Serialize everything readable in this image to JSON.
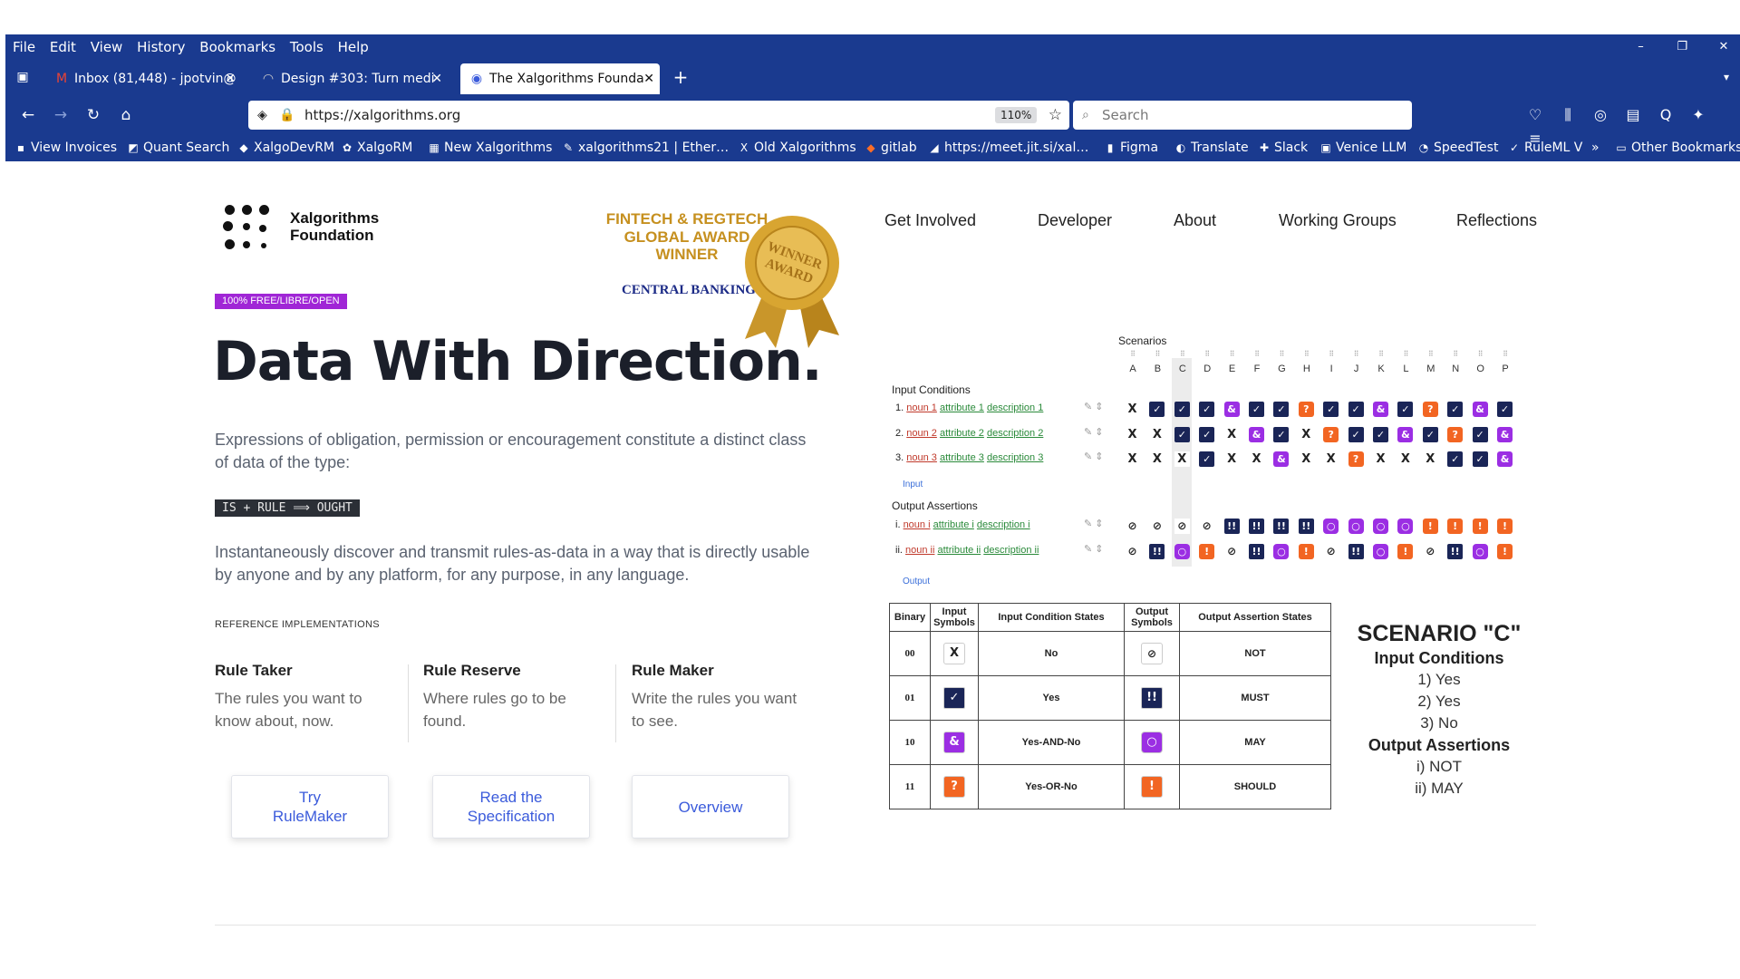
{
  "browser": {
    "menu": [
      "File",
      "Edit",
      "View",
      "History",
      "Bookmarks",
      "Tools",
      "Help"
    ],
    "window_controls": [
      "–",
      "❐",
      "✕"
    ],
    "tabs": [
      {
        "label": "Inbox (81,448) - jpotvin@",
        "icon": "gmail-icon"
      },
      {
        "label": "Design #303: Turn medi",
        "icon": "git-icon"
      },
      {
        "label": "The Xalgorithms Founda",
        "icon": "xalgo-icon"
      }
    ],
    "new_tab": "+",
    "url": "https://xalgorithms.org",
    "zoom": "110%",
    "search_placeholder": "Search",
    "bookmarks": [
      "View Invoices",
      "Quant Search",
      "XalgoDevRM",
      "XalgoRM",
      "New Xalgorithms",
      "xalgorithms21 | Ether…",
      "Old Xalgorithms",
      "gitlab",
      "https://meet.jit.si/xal…",
      "Figma",
      "Translate",
      "Slack",
      "Venice LLM",
      "SpeedTest",
      "RuleML V",
      "Other Bookmarks"
    ],
    "bookmarks_overflow": "»"
  },
  "site": {
    "logo_text_1": "Xalgorithms",
    "logo_text_2": "Foundation",
    "award_lines": [
      "FINTECH & REGTECH",
      "GLOBAL AWARD",
      "WINNER"
    ],
    "award_sub": "CENTRAL BANKING",
    "seal_line1": "WINNER",
    "seal_line2": "AWARD",
    "nav": [
      "Get Involved",
      "Developer",
      "About",
      "Working Groups",
      "Reflections"
    ],
    "badge": "100% FREE/LIBRE/OPEN",
    "title": "Data With Direction.",
    "intro": "Expressions of obligation, permission or encouragement constitute a distinct class of data of the type:",
    "code": "IS + RULE ⟹ OUGHT",
    "para2": "Instantaneously discover and transmit rules-as-data in a way that is directly usable by anyone and by any platform, for any purpose, in any language.",
    "ref_head": "REFERENCE IMPLEMENTATIONS",
    "impl": [
      {
        "title": "Rule Taker",
        "desc": "The rules you want to know about, now."
      },
      {
        "title": "Rule Reserve",
        "desc": "Where rules go to be found."
      },
      {
        "title": "Rule Maker",
        "desc": "Write the rules you want to see."
      }
    ],
    "buttons": [
      "Try RuleMaker",
      "Read the Specification",
      "Overview"
    ]
  },
  "grid": {
    "scenarios_label": "Scenarios",
    "columns": [
      "A",
      "B",
      "C",
      "D",
      "E",
      "F",
      "G",
      "H",
      "I",
      "J",
      "K",
      "L",
      "M",
      "N",
      "O",
      "P"
    ],
    "input_label": "Input Conditions",
    "inputs": [
      {
        "num": "1.",
        "noun": "noun 1",
        "attr": "attribute 1",
        "desc": "description 1",
        "cells": "XVVV AVVQ VVAV QVAV"
      },
      {
        "num": "2.",
        "noun": "noun 2",
        "attr": "attribute 2",
        "desc": "description 2",
        "cells": "XXVV XAVX QVVA VQVA"
      },
      {
        "num": "3.",
        "noun": "noun 3",
        "attr": "attribute 3",
        "desc": "description 3",
        "cells": "XXXV XXAX XQXX XVVA"
      }
    ],
    "input_link": "Input",
    "output_label": "Output Assertions",
    "outputs": [
      {
        "num": "i.",
        "noun": "noun i",
        "attr": "attribute i",
        "desc": "description i",
        "cells": "NNNN MMMM OOOO SSSS"
      },
      {
        "num": "ii.",
        "noun": "noun ii",
        "attr": "attribute ii",
        "desc": "description ii",
        "cells": "NMOS NMOS NMOS NMOS"
      }
    ],
    "output_link": "Output",
    "glyphs": {
      "X": "X",
      "V": "✓",
      "A": "&",
      "Q": "?",
      "N": "⊘",
      "M": "!!",
      "O": "○",
      "S": "!"
    }
  },
  "legend": {
    "headers": [
      "Binary",
      "Input Symbols",
      "Input Condition States",
      "Output Symbols",
      "Output Assertion States"
    ],
    "rows": [
      {
        "binary": "00",
        "in_sym": "X",
        "in_state": "No",
        "out_sym": "⊘",
        "out_state": "NOT"
      },
      {
        "binary": "01",
        "in_sym": "✓",
        "in_state": "Yes",
        "out_sym": "!!",
        "out_state": "MUST"
      },
      {
        "binary": "10",
        "in_sym": "&",
        "in_state": "Yes-AND-No",
        "out_sym": "○",
        "out_state": "MAY"
      },
      {
        "binary": "11",
        "in_sym": "?",
        "in_state": "Yes-OR-No",
        "out_sym": "!",
        "out_state": "SHOULD"
      }
    ]
  },
  "scenario": {
    "title": "SCENARIO \"C\"",
    "in_head": "Input Conditions",
    "in_lines": [
      "1) Yes",
      "2) Yes",
      "3) No"
    ],
    "out_head": "Output Assertions",
    "out_lines": [
      "i) NOT",
      "ii) MAY"
    ]
  },
  "colors": {
    "chrome": "#1a3a8f",
    "accent": "#3b5bdb",
    "badge": "#a026d6",
    "navy": "#1a2557",
    "purple": "#9b2ee3",
    "orange": "#f26522",
    "gold": "#c6901f"
  }
}
